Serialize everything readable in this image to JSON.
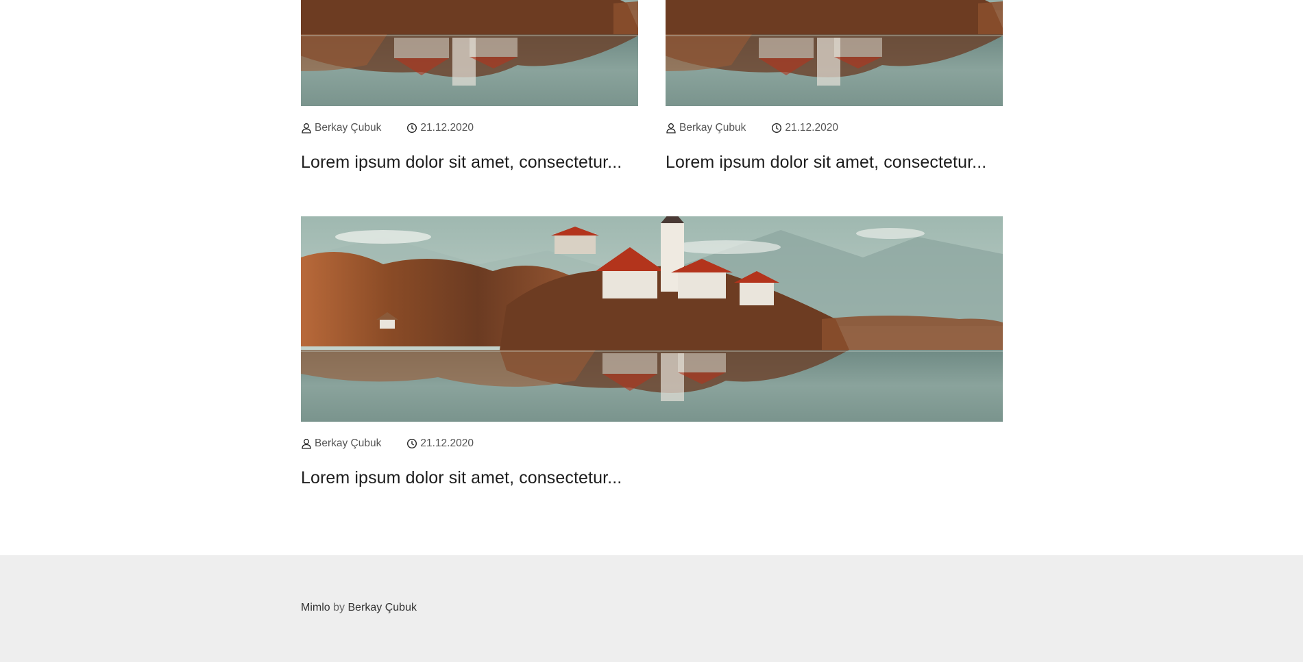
{
  "posts": [
    {
      "author": "Berkay Çubuk",
      "date": "21.12.2020",
      "title": "Lorem ipsum dolor sit amet, consectetur...",
      "image_icon": "lake-church-image"
    },
    {
      "author": "Berkay Çubuk",
      "date": "21.12.2020",
      "title": "Lorem ipsum dolor sit amet, consectetur...",
      "image_icon": "lake-church-image"
    },
    {
      "author": "Berkay Çubuk",
      "date": "21.12.2020",
      "title": "Lorem ipsum dolor sit amet, consectetur...",
      "image_icon": "lake-church-image"
    }
  ],
  "footer": {
    "site_name": "Mimlo",
    "by": "by",
    "author": "Berkay Çubuk"
  },
  "colors": {
    "footer_bg": "#eeeeee",
    "sky": "#a9c2b9",
    "water": "#7f9a92",
    "foliage": "#a35a2e",
    "roof": "#b3341c"
  },
  "icons": {
    "author": "user-icon",
    "date": "clock-icon"
  }
}
